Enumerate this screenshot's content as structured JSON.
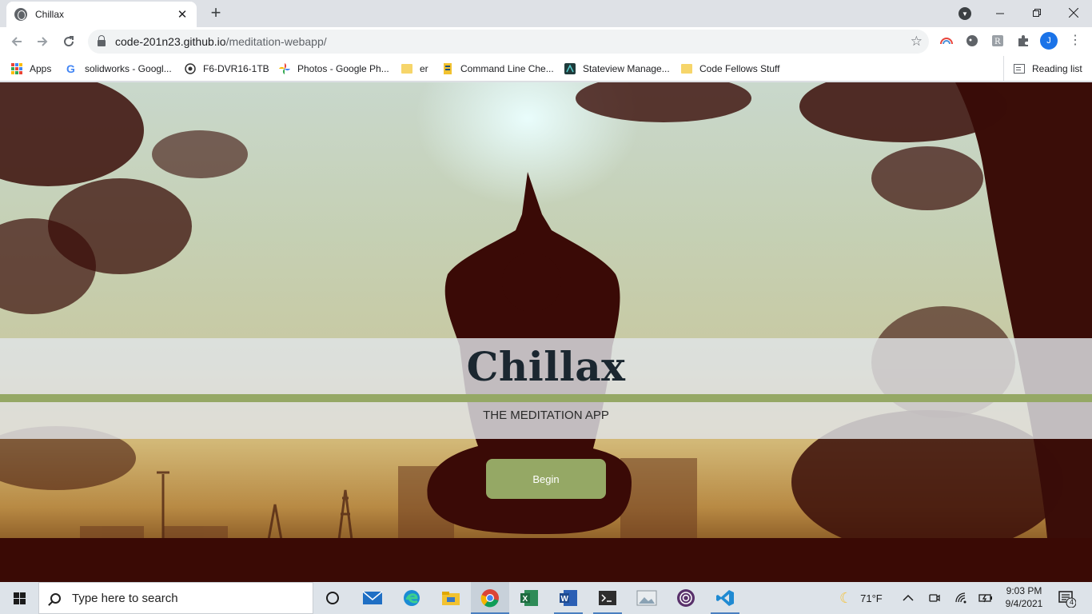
{
  "browser": {
    "tab_title": "Chillax",
    "tab_close": "✕",
    "new_tab": "+",
    "url_host": "code-201n23.github.io",
    "url_path": "/meditation-webapp/",
    "profile_initial": "J",
    "bookmarks": [
      {
        "label": "Apps",
        "icon": "apps-grid-icon"
      },
      {
        "label": "solidworks - Googl...",
        "icon": "google-icon"
      },
      {
        "label": "F6-DVR16-1TB",
        "icon": "dvr-icon"
      },
      {
        "label": "Photos - Google Ph...",
        "icon": "google-photos-icon"
      },
      {
        "label": "er",
        "icon": "folder-icon"
      },
      {
        "label": "Command Line Che...",
        "icon": "command-line-icon"
      },
      {
        "label": "Stateview Manage...",
        "icon": "stateview-icon"
      },
      {
        "label": "Code Fellows Stuff",
        "icon": "folder-icon"
      }
    ],
    "reading_list": "Reading list"
  },
  "page": {
    "brand": "Chillax",
    "tagline": "THE MEDITATION APP",
    "begin_label": "Begin",
    "colors": {
      "band": "#e1e4e8",
      "accent": "#95a865",
      "brand_text": "#1b2730"
    }
  },
  "taskbar": {
    "search_placeholder": "Type here to search",
    "weather": "71°F",
    "time": "9:03 PM",
    "date": "9/4/2021",
    "notification_count": "4"
  }
}
